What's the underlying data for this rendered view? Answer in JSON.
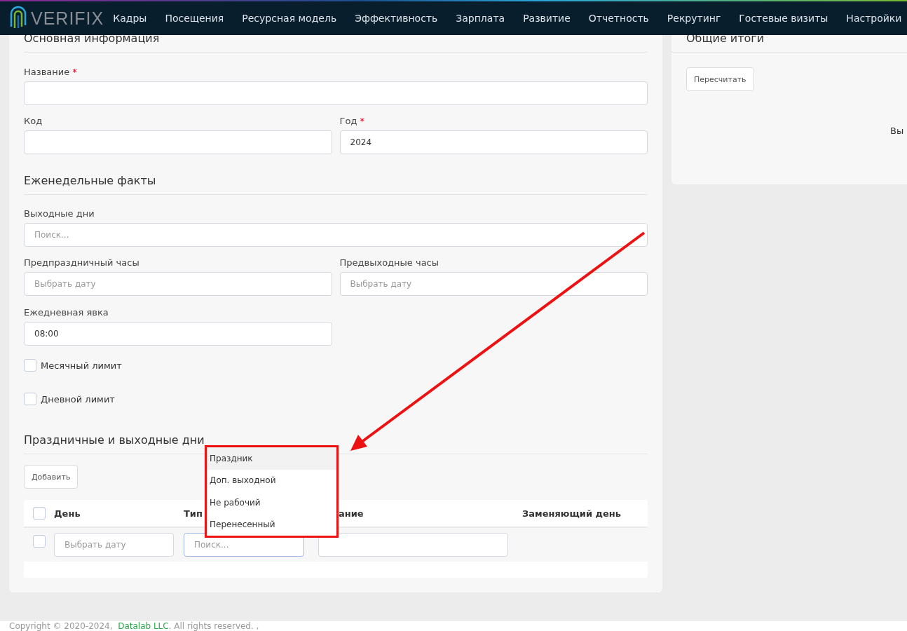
{
  "brand": {
    "name": "VERIFIX"
  },
  "nav": [
    {
      "label": "Кадры"
    },
    {
      "label": "Посещения"
    },
    {
      "label": "Ресурсная модель"
    },
    {
      "label": "Эффективность"
    },
    {
      "label": "Зарплата"
    },
    {
      "label": "Развитие"
    },
    {
      "label": "Отчетность"
    },
    {
      "label": "Рекрутинг"
    },
    {
      "label": "Гостевые визиты"
    },
    {
      "label": "Настройки"
    }
  ],
  "main_section": {
    "title": "Основная информация",
    "name_label": "Название",
    "name_required_mark": "*",
    "code_label": "Код",
    "year_label": "Год",
    "year_required_mark": "*",
    "year_value": "2024"
  },
  "weekly_section": {
    "title": "Еженедельные факты",
    "days_off_label": "Выходные дни",
    "days_off_placeholder": "Поиск...",
    "pre_holiday_label": "Предпраздничный часы",
    "pre_holiday_placeholder": "Выбрать дату",
    "pre_weekend_label": "Предвыходные часы",
    "pre_weekend_placeholder": "Выбрать дату",
    "daily_label": "Ежедневная явка",
    "daily_value": "08:00",
    "checks": [
      {
        "label": "Месячный лимит",
        "checked": false
      },
      {
        "label": "Дневной лимит",
        "checked": false
      }
    ]
  },
  "holidays_section": {
    "title": "Праздничные и выходные дни",
    "add_button": "Добавить",
    "header_checked": false,
    "columns": [
      "День",
      "Тип",
      "ание",
      "Заменяющий день"
    ],
    "row": {
      "checked": false,
      "day_placeholder": "Выбрать дату",
      "type_placeholder": "Поиск..."
    },
    "dropdown": [
      {
        "label": "Праздник",
        "selected": true
      },
      {
        "label": "Доп. выходной",
        "selected": false
      },
      {
        "label": "Не рабочий",
        "selected": false
      },
      {
        "label": "Перенесенный",
        "selected": false
      }
    ]
  },
  "totals": {
    "title": "Общие итоги",
    "button": "Пересчитать",
    "text": "Вы"
  },
  "footer": {
    "copyright": "Copyright © 2020-2024,",
    "company": "Datalab LLC",
    "rest": ". All rights reserved. ,"
  }
}
